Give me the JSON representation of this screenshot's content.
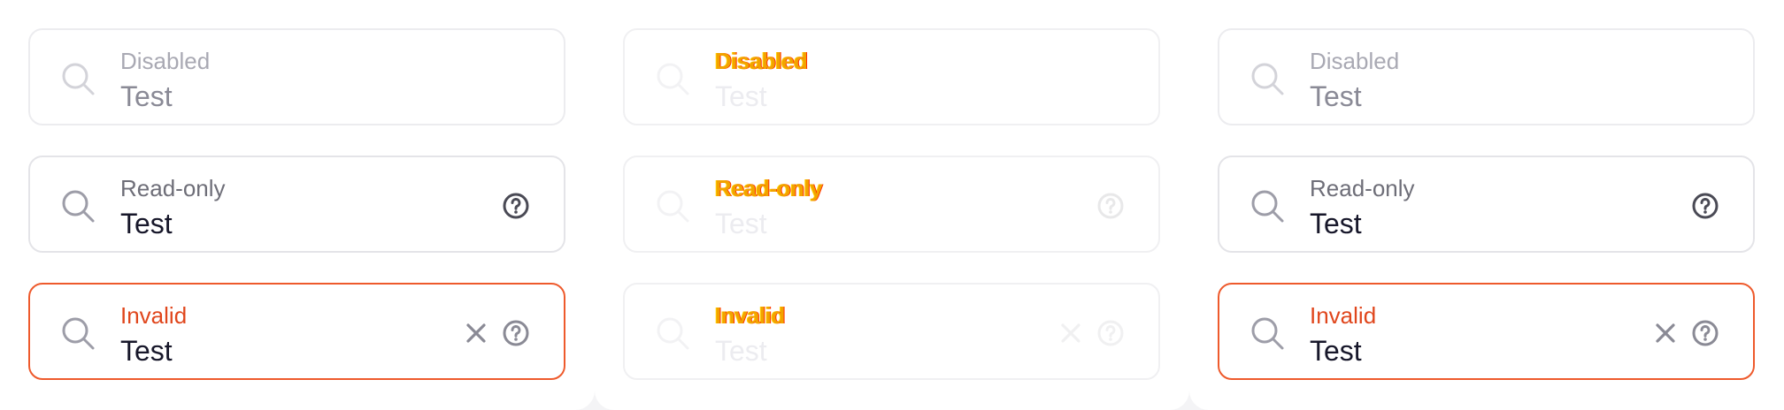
{
  "panels": [
    {
      "fields": [
        {
          "label": "Disabled",
          "value": "Test",
          "state": "disabled"
        },
        {
          "label": "Read-only",
          "value": "Test",
          "state": "readonly"
        },
        {
          "label": "Invalid",
          "value": "Test",
          "state": "invalid"
        }
      ]
    },
    {
      "fields": [
        {
          "label": "Disabled",
          "value": "Test",
          "state": "disabled"
        },
        {
          "label": "Read-only",
          "value": "Test",
          "state": "readonly"
        },
        {
          "label": "Invalid",
          "value": "Test",
          "state": "invalid"
        }
      ]
    },
    {
      "fields": [
        {
          "label": "Disabled",
          "value": "Test",
          "state": "disabled"
        },
        {
          "label": "Read-only",
          "value": "Test",
          "state": "readonly"
        },
        {
          "label": "Invalid",
          "value": "Test",
          "state": "invalid"
        }
      ]
    }
  ],
  "icons": {
    "search": "search-icon",
    "help": "help-icon",
    "clear": "clear-icon"
  },
  "colors": {
    "border": "#e4e4e8",
    "invalid": "#ee5a2c",
    "label": "#6e6e78",
    "text": "#17172a"
  }
}
